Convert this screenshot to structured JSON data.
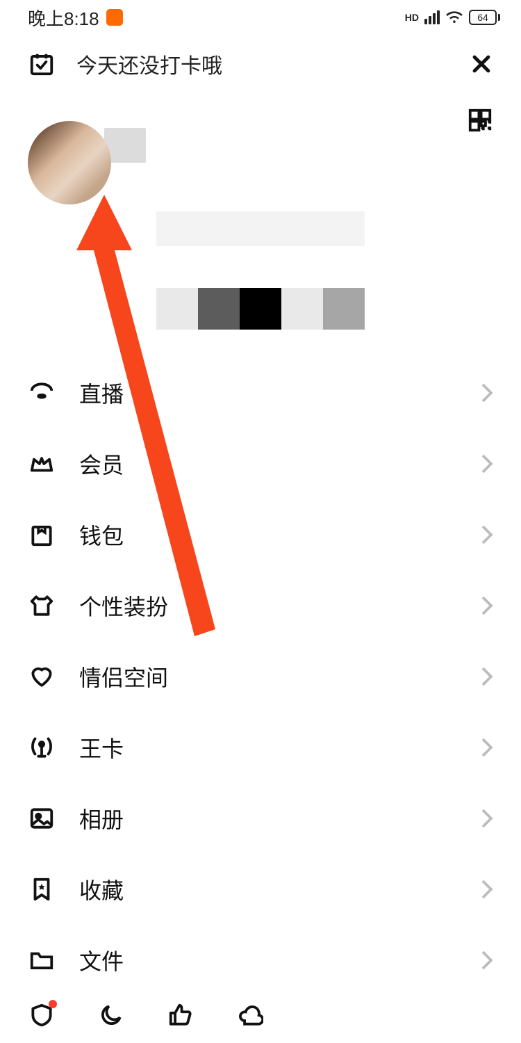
{
  "status": {
    "time": "晚上8:18",
    "hd": "HD",
    "battery": "64"
  },
  "checkin": {
    "label": "今天还没打卡哦"
  },
  "menu": {
    "items": [
      {
        "key": "live",
        "label": "直播"
      },
      {
        "key": "vip",
        "label": "会员"
      },
      {
        "key": "wallet",
        "label": "钱包"
      },
      {
        "key": "decor",
        "label": "个性装扮"
      },
      {
        "key": "couple",
        "label": "情侣空间"
      },
      {
        "key": "wangka",
        "label": "王卡"
      },
      {
        "key": "album",
        "label": "相册"
      },
      {
        "key": "fav",
        "label": "收藏"
      },
      {
        "key": "file",
        "label": "文件"
      }
    ]
  }
}
